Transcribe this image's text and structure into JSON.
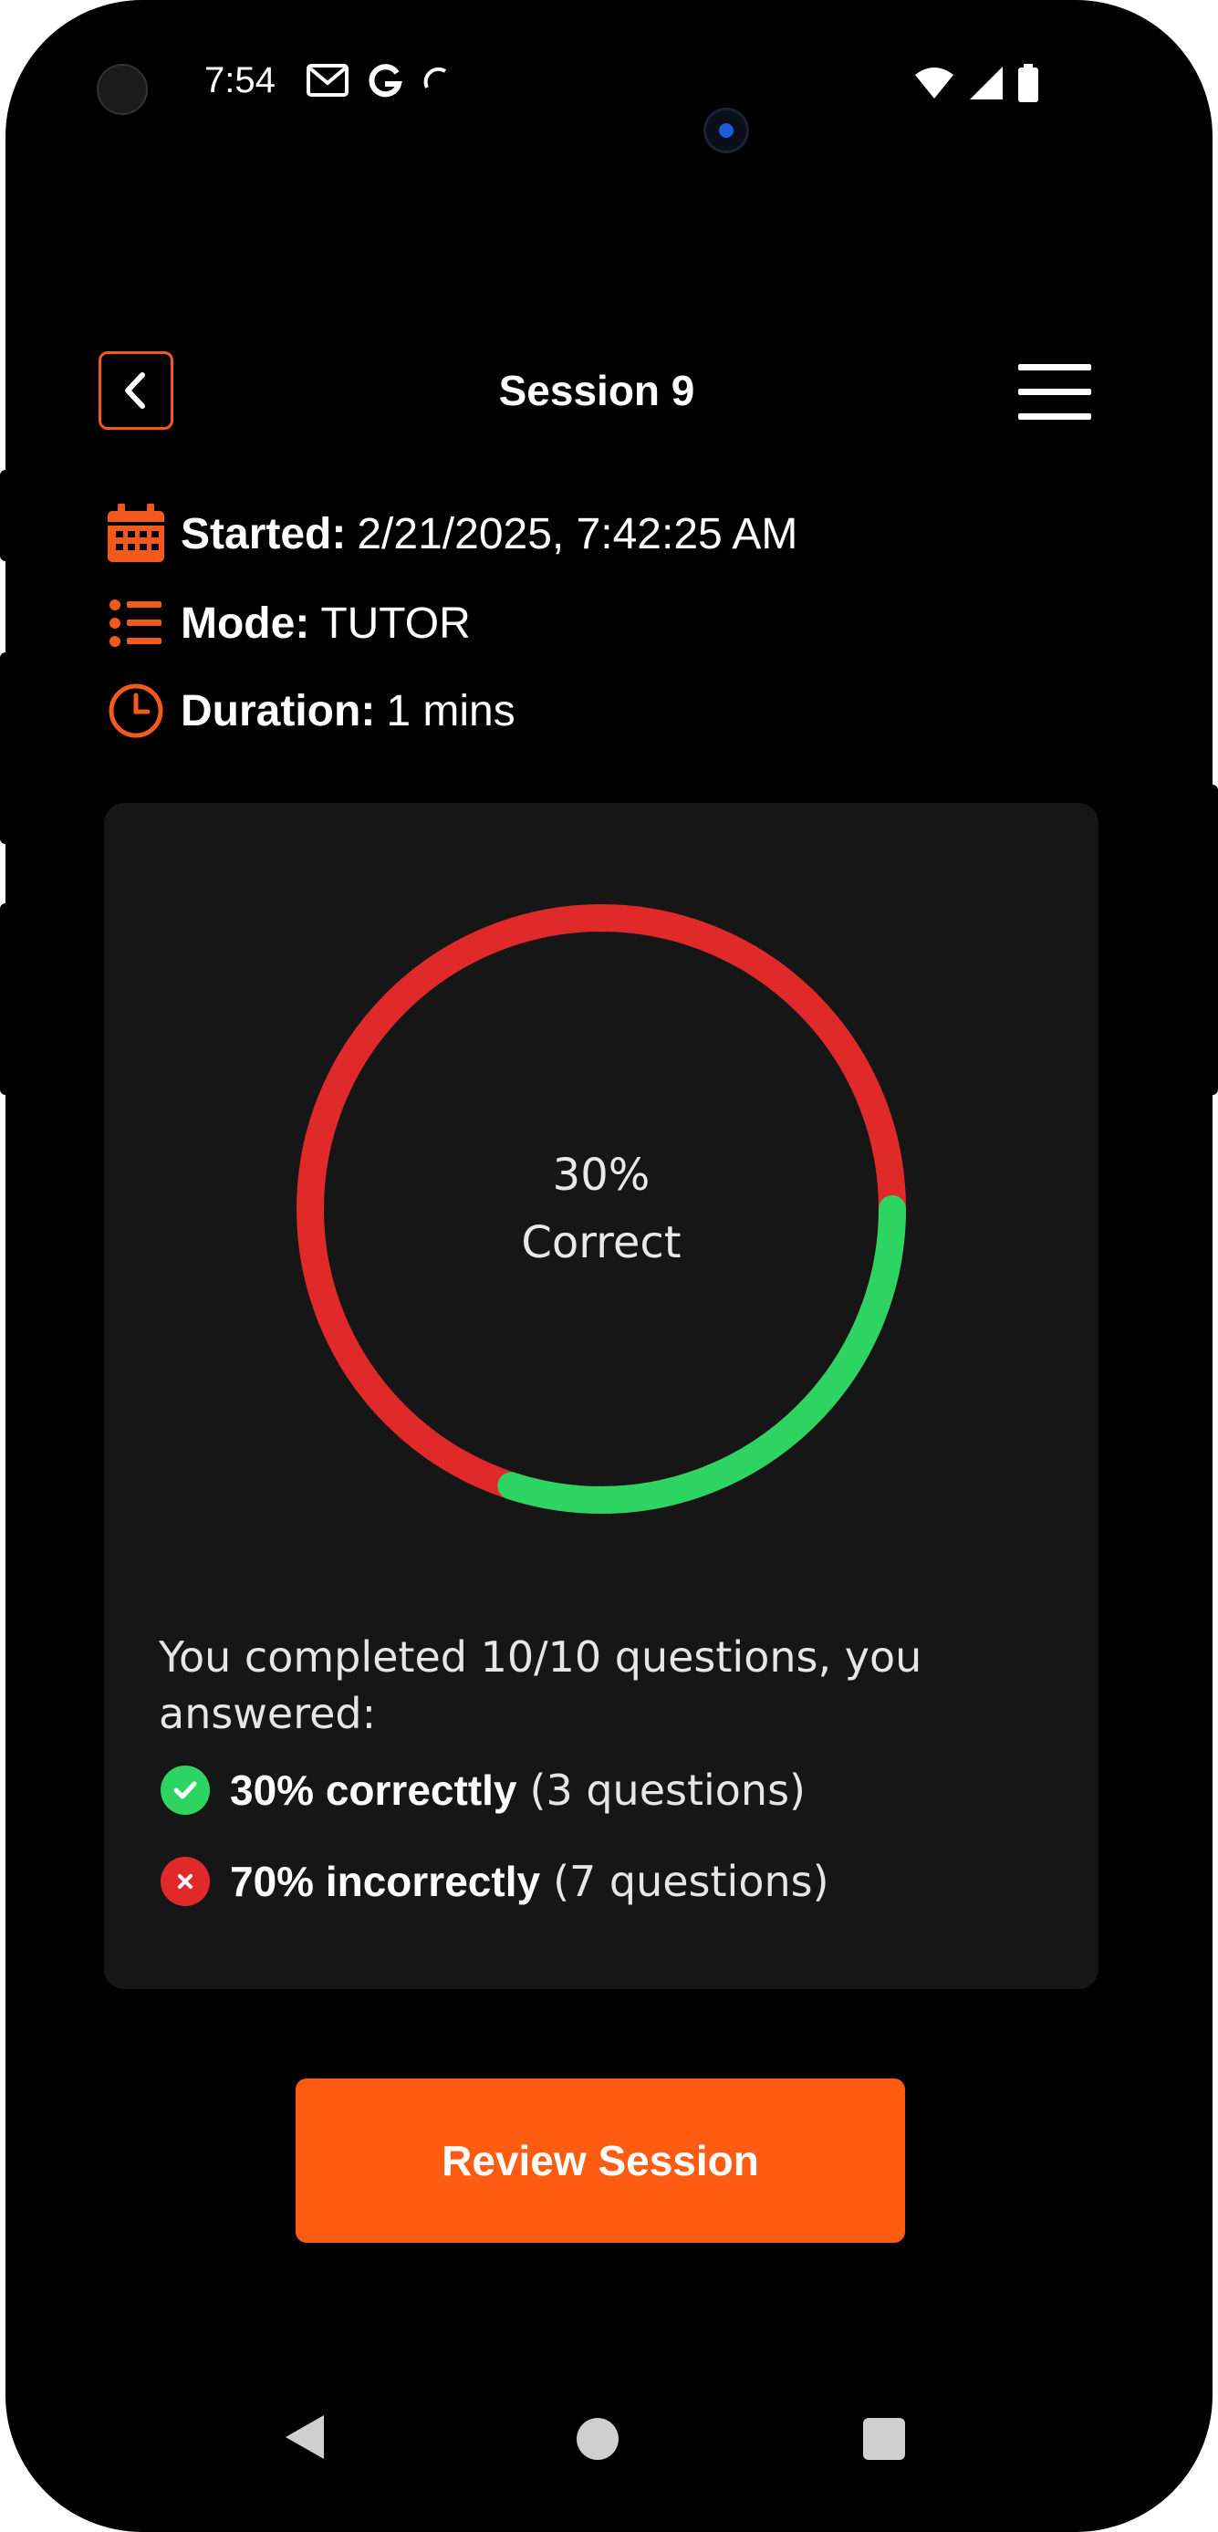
{
  "status_bar": {
    "time": "7:54",
    "left_icons": [
      "gmail-icon",
      "google-icon",
      "sync-icon"
    ],
    "right_icons": [
      "wifi-icon",
      "signal-icon",
      "battery-icon"
    ]
  },
  "header": {
    "title": "Session 9",
    "back_icon": "chevron-left-icon",
    "menu_icon": "hamburger-menu-icon"
  },
  "meta": {
    "started_label": "Started:",
    "started_value": "2/21/2025, 7:42:25 AM",
    "mode_label": "Mode:",
    "mode_value": "TUTOR",
    "duration_label": "Duration:",
    "duration_value": "1 mins"
  },
  "progress": {
    "correct_fraction": 0.3,
    "center_percent": "30%",
    "center_label": "Correct",
    "colors": {
      "correct": "#2ed462",
      "incorrect": "#e02a2a",
      "accent": "#f15a1b"
    }
  },
  "summary": {
    "text": "You completed 10/10 questions, you answered:",
    "correct_bold": "30% correcttly",
    "correct_detail": "(3 questions)",
    "incorrect_bold": "70% incorrectly",
    "incorrect_detail": "(7 questions)"
  },
  "actions": {
    "review_label": "Review Session"
  },
  "nav_bar": {
    "icons": [
      "nav-back-icon",
      "nav-home-icon",
      "nav-recents-icon"
    ]
  }
}
